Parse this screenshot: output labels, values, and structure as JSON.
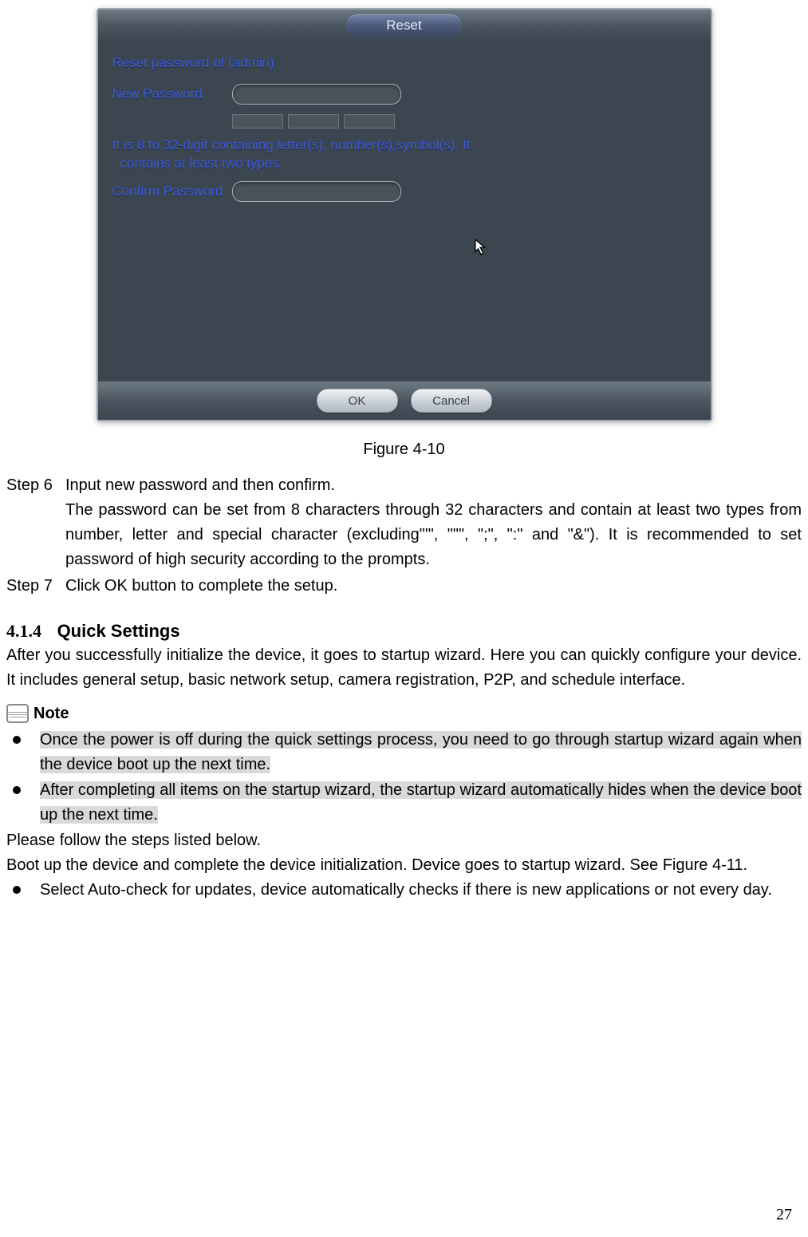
{
  "dialog": {
    "title": "Reset",
    "heading": "Reset password of (admin)",
    "new_password_label": "New Password",
    "hint_line1": "It is 8 to 32-digit containing letter(s), number(s),symbol(s). It",
    "hint_line2": "contains at least two types.",
    "confirm_label": "Confirm Password",
    "ok_label": "OK",
    "cancel_label": "Cancel"
  },
  "figure_caption": "Figure 4-10",
  "steps": {
    "step6_label": "Step 6",
    "step6_line1": "Input new password and then confirm.",
    "step6_line2": "The password can be set from 8 characters through 32 characters and contain at least two types from number, letter and special character (excluding\"'\", \"\"\", \";\", \":\" and \"&\"). It is recommended to set password of high security according to the prompts.",
    "step7_label": "Step 7",
    "step7_text": "Click OK button to complete the setup."
  },
  "section": {
    "number": "4.1.4",
    "title": "Quick Settings",
    "intro": "After you successfully initialize the device, it goes to startup wizard. Here you can quickly configure your device. It includes general setup, basic network setup, camera registration, P2P, and schedule interface."
  },
  "note": {
    "label": "Note",
    "bullets": [
      "Once the power is off during the quick settings process, you need to go through startup wizard again when the device boot up the next time.",
      "After completing all items on the startup wizard, the startup wizard automatically hides when the device boot up the next time."
    ]
  },
  "followup": {
    "line1": "Please follow the steps listed below.",
    "line2": "Boot up the device and complete the device initialization. Device goes to startup wizard. See Figure 4-11.",
    "bullet": "Select Auto-check for updates, device automatically checks if there is new applications or not every day."
  },
  "page_number": "27"
}
